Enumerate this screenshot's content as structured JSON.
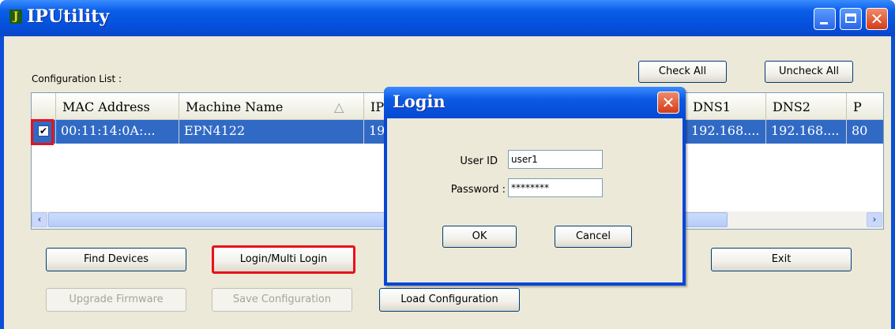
{
  "window": {
    "title": "IPUtility",
    "app_icon": "J"
  },
  "title_buttons": {
    "minimize": "minimize-icon",
    "maximize": "maximize-icon",
    "close": "✕"
  },
  "config_label": "Configuration List :",
  "top_buttons": {
    "check_all": "Check All",
    "uncheck_all": "Uncheck All"
  },
  "list": {
    "columns": [
      "MAC Address",
      "Machine Name",
      "IP",
      "DNS1",
      "DNS2",
      "P"
    ],
    "sort_indicator": "△",
    "rows": [
      {
        "checked": "✔",
        "mac": "00:11:14:0A:...",
        "name": "EPN4122",
        "ip": "19",
        "dns1": "192.168....",
        "dns2": "192.168....",
        "port": "80"
      }
    ]
  },
  "scrollbar": {
    "left_arrow": "‹",
    "right_arrow": "›"
  },
  "actions": {
    "find_devices": "Find Devices",
    "login": "Login/Multi Login",
    "exit": "Exit",
    "upgrade_firmware": "Upgrade Firmware",
    "save_configuration": "Save Configuration",
    "load_configuration": "Load Configuration"
  },
  "login_dialog": {
    "title": "Login",
    "user_id_label": "User ID",
    "user_id_value": "user1",
    "password_label": "Password :",
    "password_value": "********",
    "ok": "OK",
    "cancel": "Cancel"
  },
  "colors": {
    "titlebar": "#0a5ee8",
    "selection": "#316ac5",
    "highlight": "#e8111b",
    "face": "#ece9d8"
  }
}
